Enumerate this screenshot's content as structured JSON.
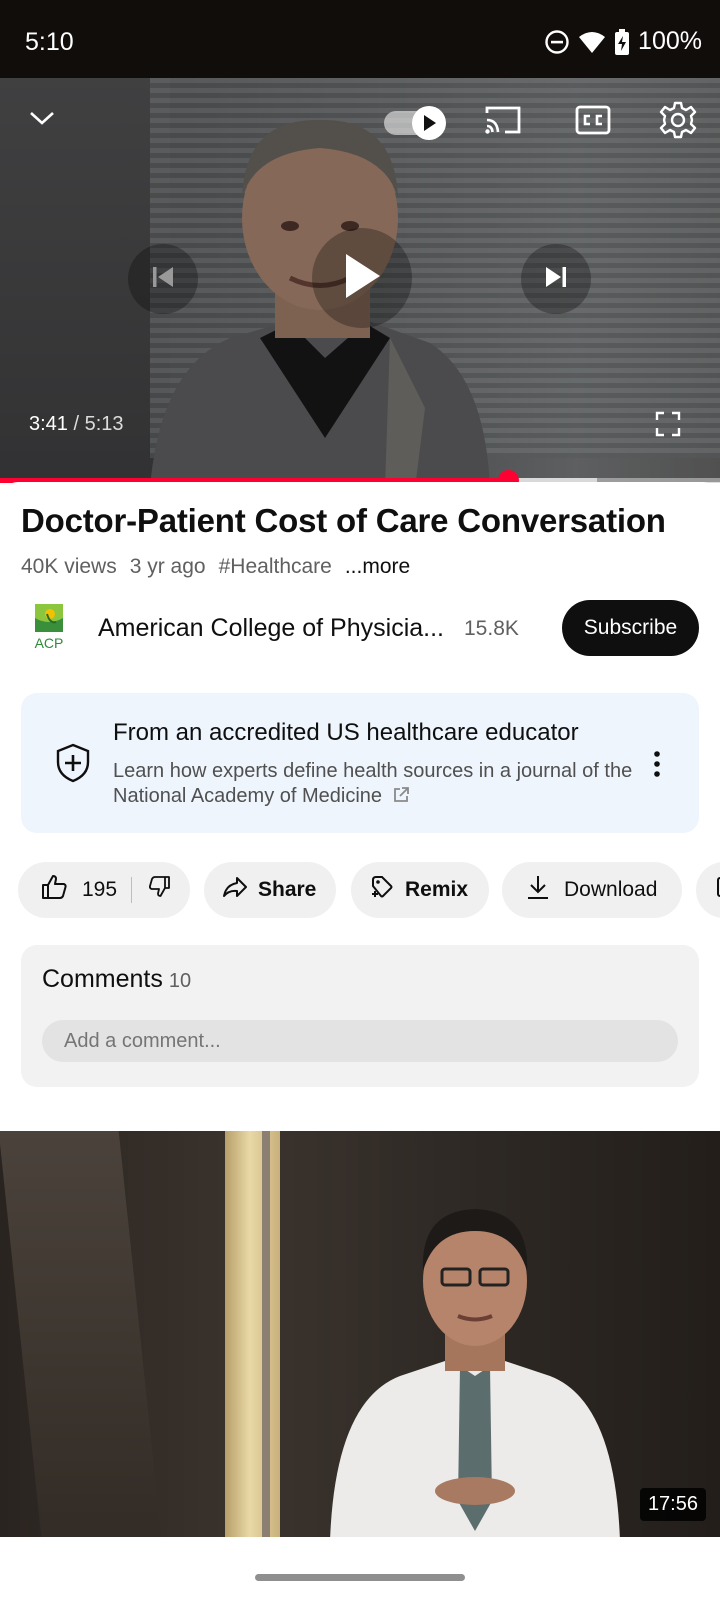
{
  "status_bar": {
    "time": "5:10",
    "battery": "100%"
  },
  "player": {
    "current_time": "3:41",
    "separator": " / ",
    "duration": "5:13",
    "progress_fraction": 0.705,
    "buffer_fraction": 0.829,
    "accent_color": "#ff0033"
  },
  "video": {
    "title": "Doctor-Patient Cost of Care Conversation",
    "views": "40K views",
    "age": "3 yr ago",
    "hashtag": "#Healthcare",
    "more": "...more"
  },
  "channel": {
    "logo_text": "ACP",
    "name": "American College of Physicia...",
    "subscribers": "15.8K",
    "subscribe_label": "Subscribe"
  },
  "info_panel": {
    "title": "From an accredited US healthcare educator",
    "description": "Learn how experts define health sources in a journal of the National Academy of Medicine"
  },
  "actions": {
    "like_count": "195",
    "share_label": "Share",
    "remix_label": "Remix",
    "download_label": "Download"
  },
  "comments": {
    "label": "Comments",
    "count": "10",
    "placeholder": "Add a comment..."
  },
  "next_video": {
    "duration": "17:56"
  }
}
